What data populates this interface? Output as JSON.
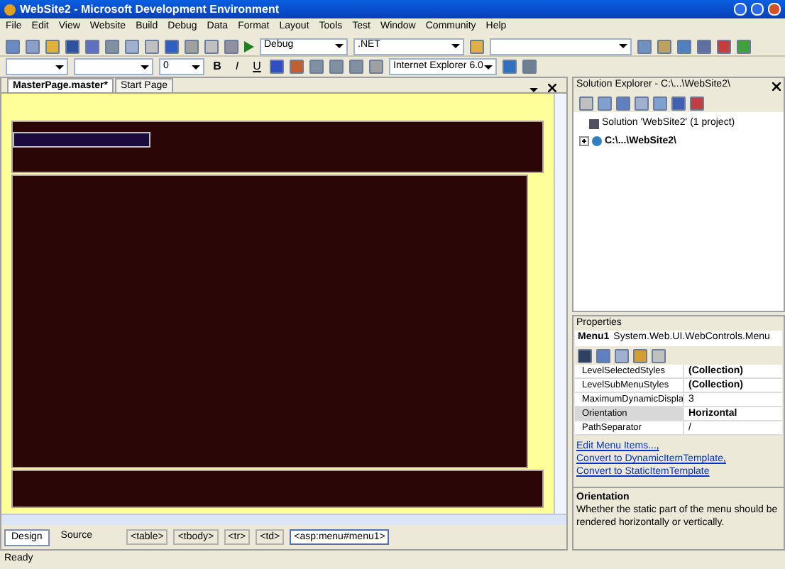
{
  "window": {
    "title": "WebSite2 - Microsoft Development Environment"
  },
  "menu": [
    "File",
    "Edit",
    "View",
    "Website",
    "Build",
    "Debug",
    "Data",
    "Format",
    "Layout",
    "Tools",
    "Test",
    "Window",
    "Community",
    "Help"
  ],
  "toolbar1": {
    "config": "Debug",
    "platform": ".NET"
  },
  "toolbar2": {
    "size": "0",
    "format_buttons": [
      {
        "label": "B",
        "kind": "bold"
      },
      {
        "label": "I",
        "kind": "italic"
      },
      {
        "label": "U",
        "kind": "underline"
      }
    ],
    "target": "Internet Explorer 6.0"
  },
  "document_tabs": [
    {
      "label": "MasterPage.master*",
      "selected": true
    },
    {
      "label": "Start Page",
      "selected": false
    }
  ],
  "view_tabs": [
    {
      "label": "Design",
      "selected": true
    },
    {
      "label": "Source",
      "selected": false
    }
  ],
  "tag_path": [
    {
      "label": "<table>",
      "selected": false
    },
    {
      "label": "<tbody>",
      "selected": false
    },
    {
      "label": "<tr>",
      "selected": false
    },
    {
      "label": "<td>",
      "selected": false
    },
    {
      "label": "<asp:menu#menu1>",
      "selected": true
    }
  ],
  "solution_explorer": {
    "title": "Solution Explorer - C:\\...\\WebSite2\\",
    "items": [
      {
        "label": "Solution 'WebSite2' (1 project)",
        "kind": "solution"
      },
      {
        "label": "C:\\...\\WebSite2\\",
        "kind": "project",
        "expanded": false
      }
    ]
  },
  "properties": {
    "title": "Properties",
    "object": "Menu1",
    "type": "System.Web.UI.WebControls.Menu",
    "rows": [
      {
        "name": "LevelSelectedStyles",
        "value": "(Collection)",
        "modified": true,
        "selected": false
      },
      {
        "name": "LevelSubMenuStyles",
        "value": "(Collection)",
        "modified": true,
        "selected": false
      },
      {
        "name": "MaximumDynamicDispla",
        "value": "3",
        "modified": false,
        "selected": false
      },
      {
        "name": "Orientation",
        "value": "Horizontal",
        "modified": true,
        "selected": true
      },
      {
        "name": "PathSeparator",
        "value": "/",
        "modified": false,
        "selected": false
      }
    ],
    "commands": [
      "Edit Menu Items...",
      "Convert to DynamicItemTemplate",
      "Convert to StaticItemTemplate"
    ],
    "command_separator": ",",
    "description_title": "Orientation",
    "description": "Whether the static part of the menu should be rendered horizontally or vertically."
  },
  "status_bar": "Ready"
}
